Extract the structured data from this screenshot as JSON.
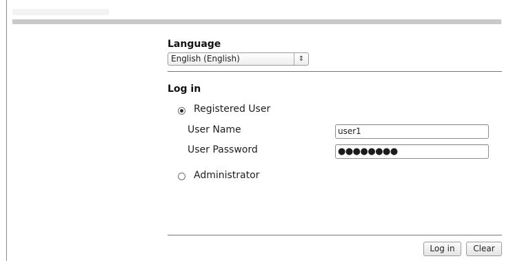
{
  "language": {
    "title": "Language",
    "selected": "English (English)",
    "arrow_icon": "updown-arrows-icon"
  },
  "login": {
    "title": "Log in",
    "options": {
      "registered": {
        "label": "Registered User",
        "checked": true
      },
      "administrator": {
        "label": "Administrator",
        "checked": false
      }
    },
    "username_label": "User Name",
    "username_value": "user1",
    "password_label": "User Password",
    "password_value": "●●●●●●●●"
  },
  "buttons": {
    "login": "Log in",
    "clear": "Clear"
  }
}
